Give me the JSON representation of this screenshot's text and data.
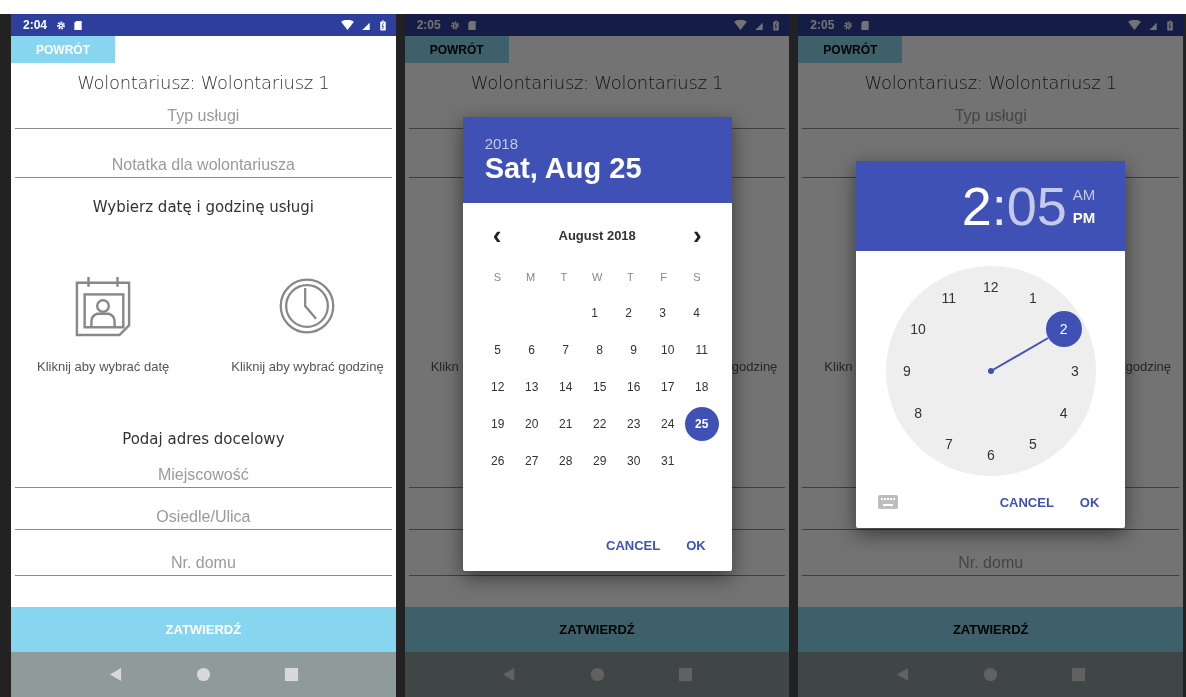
{
  "phones": [
    {
      "status": {
        "time": "2:04"
      },
      "back_button": "POWRÓT",
      "title": "Wolontariusz: Wolontariusz 1",
      "service_type_field": {
        "placeholder": "Typ usługi"
      },
      "note_field": {
        "placeholder": "Notatka dla wolontariusza"
      },
      "schedule_heading": "Wybierz datę i godzinę usługi",
      "pickers": [
        {
          "kind": "date",
          "label": "Kliknij aby wybrać datę"
        },
        {
          "kind": "time",
          "label": "Kliknij aby wybrać godzinę"
        }
      ],
      "address_heading": "Podaj adres docelowy",
      "city_field": {
        "placeholder": "Miejscowość"
      },
      "street_field": {
        "placeholder": "Osiedle/Ulica"
      },
      "house_number_field": {
        "placeholder": "Nr. domu"
      },
      "submit_button": "ZATWIERDŹ"
    },
    {
      "status": {
        "time": "2:05"
      },
      "back_button": "POWRÓT",
      "title": "Wolontariusz: Wolontariusz 1",
      "pickers": [
        {
          "label": "Klikn"
        },
        {
          "label": "godzinę"
        }
      ],
      "submit_button": "ZATWIERDŹ",
      "dialog": {
        "kind": "date",
        "year": {
          "text": "2018",
          "selected": false
        },
        "date": {
          "text": "Sat, Aug 25",
          "selected": true
        },
        "prev": "‹",
        "month": "August 2018",
        "next": "›",
        "weekdays": [
          "S",
          "M",
          "T",
          "W",
          "T",
          "F",
          "S"
        ],
        "weeks": [
          [
            {
              "day": "1",
              "selected": false
            },
            {
              "day": "2",
              "selected": false
            },
            {
              "day": "3",
              "selected": false
            },
            {
              "day": "4",
              "selected": false
            }
          ],
          [
            {
              "day": "5",
              "selected": false
            },
            {
              "day": "6",
              "selected": false
            },
            {
              "day": "7",
              "selected": false
            },
            {
              "day": "8",
              "selected": false
            },
            {
              "day": "9",
              "selected": false
            },
            {
              "day": "10",
              "selected": false
            },
            {
              "day": "11",
              "selected": false
            }
          ],
          [
            {
              "day": "12",
              "selected": false
            },
            {
              "day": "13",
              "selected": false
            },
            {
              "day": "14",
              "selected": false
            },
            {
              "day": "15",
              "selected": false
            },
            {
              "day": "16",
              "selected": false
            },
            {
              "day": "17",
              "selected": false
            },
            {
              "day": "18",
              "selected": false
            }
          ],
          [
            {
              "day": "19",
              "selected": false
            },
            {
              "day": "20",
              "selected": false
            },
            {
              "day": "21",
              "selected": false
            },
            {
              "day": "22",
              "selected": false
            },
            {
              "day": "23",
              "selected": false
            },
            {
              "day": "24",
              "selected": false
            },
            {
              "day": "25",
              "selected": true
            }
          ],
          [
            {
              "day": "26",
              "selected": false
            },
            {
              "day": "27",
              "selected": false
            },
            {
              "day": "28",
              "selected": false
            },
            {
              "day": "29",
              "selected": false
            },
            {
              "day": "30",
              "selected": false
            },
            {
              "day": "31",
              "selected": false
            }
          ]
        ],
        "buttons": [
          "CANCEL",
          "OK"
        ]
      }
    },
    {
      "status": {
        "time": "2:05"
      },
      "back_button": "POWRÓT",
      "title": "Wolontariusz: Wolontariusz 1",
      "service_type_field": {
        "placeholder": "Typ usługi"
      },
      "pickers": [
        {
          "label": "Klikn"
        },
        {
          "label": "godzinę"
        }
      ],
      "house_number_field": {
        "placeholder": "Nr. domu"
      },
      "submit_button": "ZATWIERDŹ",
      "dialog": {
        "kind": "time",
        "hour": {
          "text": "2",
          "selected": true
        },
        "separator": ":",
        "minute": {
          "text": "05",
          "selected": false
        },
        "periods": [
          {
            "text": "AM",
            "selected": false
          },
          {
            "text": "PM",
            "selected": true
          }
        ],
        "numbers": [
          {
            "text": "12",
            "selected": false
          },
          {
            "text": "1",
            "selected": false
          },
          {
            "text": "2",
            "selected": true
          },
          {
            "text": "3",
            "selected": false
          },
          {
            "text": "4",
            "selected": false
          },
          {
            "text": "5",
            "selected": false
          },
          {
            "text": "6",
            "selected": false
          },
          {
            "text": "7",
            "selected": false
          },
          {
            "text": "8",
            "selected": false
          },
          {
            "text": "9",
            "selected": false
          },
          {
            "text": "10",
            "selected": false
          },
          {
            "text": "11",
            "selected": false
          }
        ],
        "buttons": [
          "CANCEL",
          "OK"
        ]
      }
    }
  ]
}
